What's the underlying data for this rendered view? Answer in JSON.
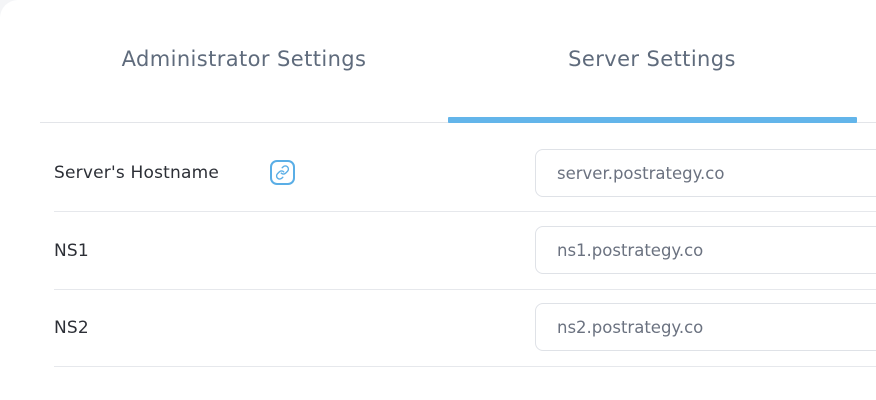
{
  "tabs": [
    {
      "label": "Administrator Settings",
      "active": false
    },
    {
      "label": "Server Settings",
      "active": true
    }
  ],
  "colors": {
    "accent": "#63b5ea",
    "label_text": "#2c2f36",
    "tab_text": "#5f6b7c",
    "input_text": "#6b7280"
  },
  "fields": {
    "hostname": {
      "label": "Server's Hostname",
      "value": "server.postrategy.co",
      "icon": "link-icon"
    },
    "ns1": {
      "label": "NS1",
      "value": "ns1.postrategy.co"
    },
    "ns2": {
      "label": "NS2",
      "value": "ns2.postrategy.co"
    }
  }
}
